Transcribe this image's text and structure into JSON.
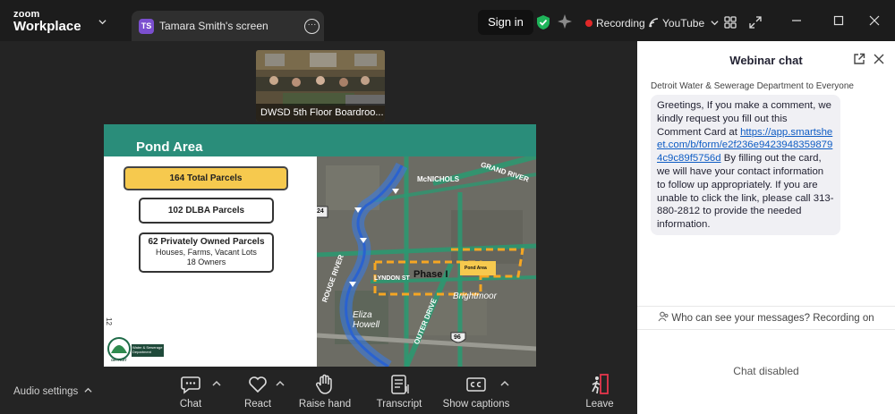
{
  "app": {
    "logo_line1": "zoom",
    "logo_line2": "Workplace"
  },
  "tab": {
    "avatar_initials": "TS",
    "label": "Tamara Smith's screen"
  },
  "header": {
    "sign_in": "Sign in",
    "recording": "Recording",
    "youtube": "YouTube"
  },
  "video": {
    "label": "DWSD 5th Floor Boardroo..."
  },
  "slide": {
    "title": "Pond Area",
    "total_parcels": "164 Total Parcels",
    "dlba_parcels": "102 DLBA Parcels",
    "private_parcels": "62 Privately Owned Parcels",
    "private_sub1": "Houses, Farms, Vacant Lots",
    "private_sub2": "18 Owners",
    "page_number": "12",
    "logo_text": "Water & Sewerage Department",
    "logo_city": "DETROIT",
    "map_labels": {
      "mcnichols": "McNICHOLS",
      "grand_river": "GRAND RIVER",
      "rouge_river": "ROUGE RIVER",
      "lyndon": "LYNDON ST",
      "phase": "Phase I",
      "pond_area": "Pond Area",
      "brightmoor": "Brightmoor",
      "eliza_howell": "Eliza Howell",
      "outer_drive": "OUTER DRIVE",
      "hwy_96": "96",
      "hwy_24": "24"
    }
  },
  "chat": {
    "title": "Webinar chat",
    "sender": "Detroit Water & Sewerage Department to Everyone",
    "message_part1": "Greetings, If you make a comment, we kindly request you fill out this Comment Card at ",
    "message_link": "https://app.smartsheet.com/b/form/e2f236e94239483598794c9c89f5756d",
    "message_part2": " By filling out the card, we will have your contact information to follow up appropriately. If you are unable to click the link, please call 313-880-2812 to provide the needed information.",
    "who_can_see": "Who can see your messages? Recording on",
    "disabled": "Chat disabled"
  },
  "toolbar": {
    "audio_settings": "Audio settings",
    "chat": "Chat",
    "react": "React",
    "raise_hand": "Raise hand",
    "transcript": "Transcript",
    "show_captions": "Show captions",
    "leave": "Leave"
  },
  "colors": {
    "slide_header": "#2a8d7a",
    "total_box": "#f6c94e",
    "recording_dot": "#e02828",
    "shield": "#1fb45a",
    "link": "#0e5cc4",
    "leave": "#e5364c"
  }
}
